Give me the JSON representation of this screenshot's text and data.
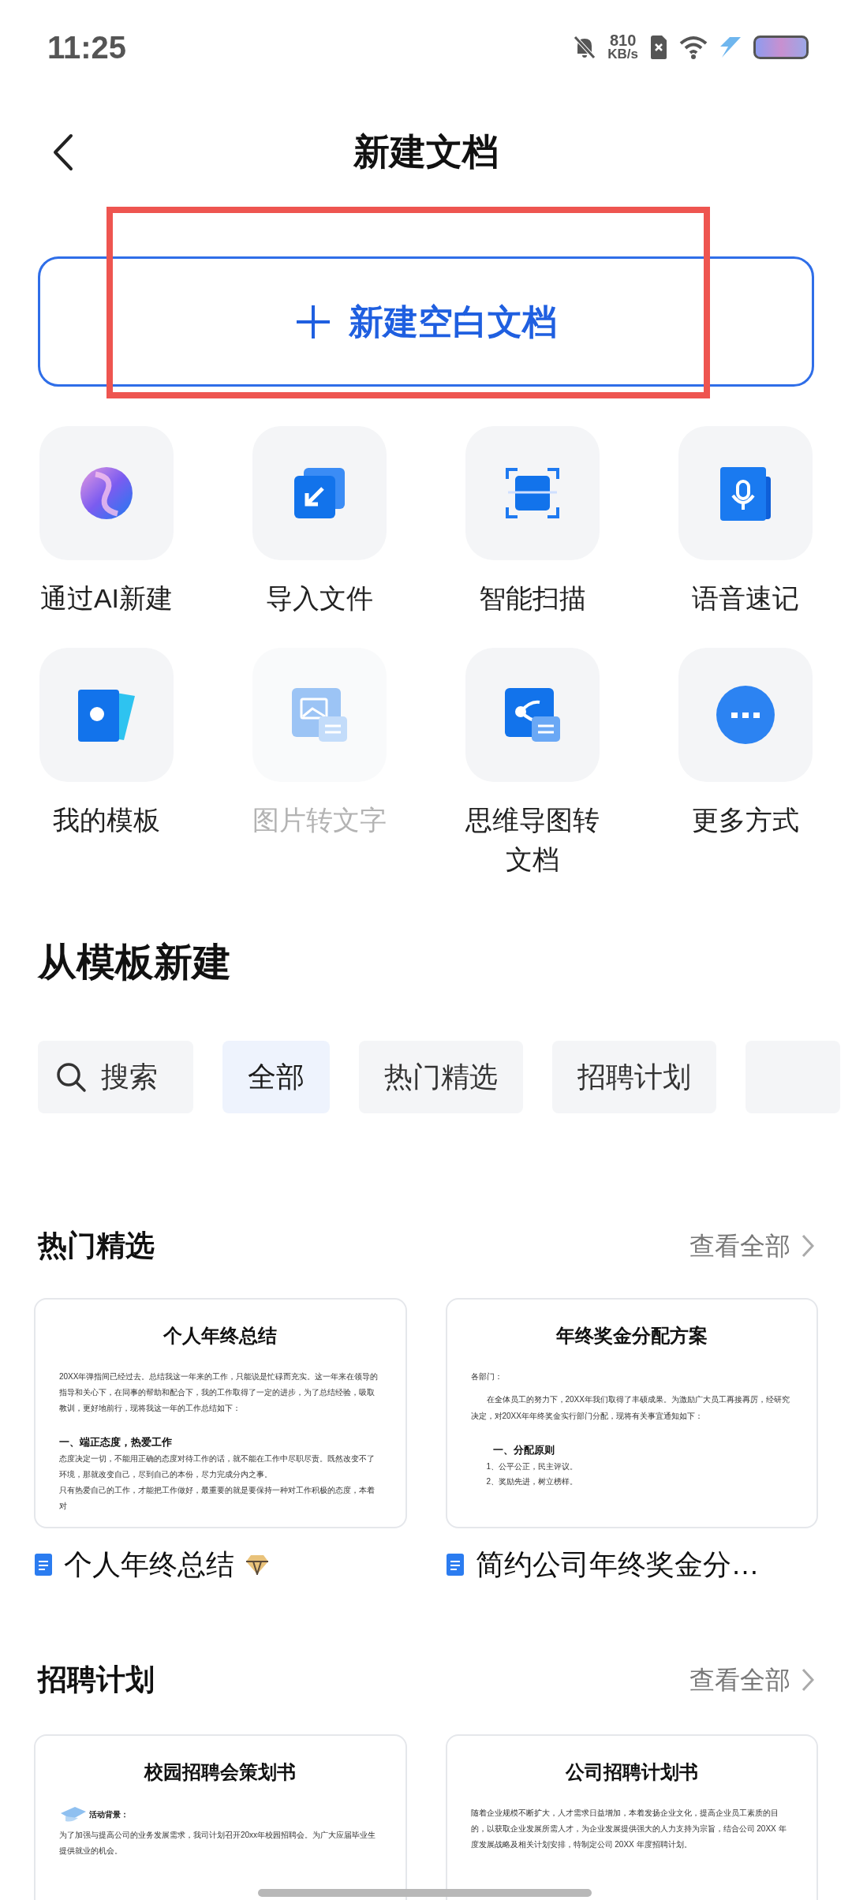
{
  "status_bar": {
    "time": "11:25",
    "net_speed": "810",
    "net_unit": "KB/s"
  },
  "header": {
    "title": "新建文档"
  },
  "new_blank": {
    "label": "新建空白文档"
  },
  "actions": [
    {
      "kind": "ai",
      "label": "通过AI新建",
      "disabled": false
    },
    {
      "kind": "import",
      "label": "导入文件",
      "disabled": false
    },
    {
      "kind": "scan",
      "label": "智能扫描",
      "disabled": false
    },
    {
      "kind": "voice",
      "label": "语音速记",
      "disabled": false
    },
    {
      "kind": "template",
      "label": "我的模板",
      "disabled": false
    },
    {
      "kind": "image_text",
      "label": "图片转文字",
      "disabled": true
    },
    {
      "kind": "mindmap",
      "label": "思维导图转文档",
      "disabled": false
    },
    {
      "kind": "more",
      "label": "更多方式",
      "disabled": false
    }
  ],
  "template_section": {
    "title": "从模板新建"
  },
  "filters": [
    {
      "kind": "search",
      "label": "搜索",
      "selected": false
    },
    {
      "kind": "chip",
      "label": "全部",
      "selected": true
    },
    {
      "kind": "chip",
      "label": "热门精选",
      "selected": false
    },
    {
      "kind": "chip",
      "label": "招聘计划",
      "selected": false
    },
    {
      "kind": "cut"
    }
  ],
  "groups": [
    {
      "title": "热门精选",
      "view_all": "查看全部",
      "templates": [
        {
          "name": "个人年终总结",
          "premium": true,
          "doc": {
            "title": "个人年终总结",
            "lines": [
              {
                "kind": "p",
                "text": "20XX年弹指间已经过去。总结我这一年来的工作，只能说是忙碌而充实。这一年来在领导的指导和关心下，在同事的帮助和配合下，我的工作取得了一定的进步，为了总结经验，吸取教训，更好地前行，现将我这一年的工作总结如下："
              },
              {
                "kind": "h",
                "text": "一、端正态度，热爱工作"
              },
              {
                "kind": "p",
                "text": "态度决定一切，不能用正确的态度对待工作的话，就不能在工作中尽职尽责。既然改变不了环境，那就改变自己，尽到自己的本份，尽力完成分内之事。"
              },
              {
                "kind": "p",
                "text": "只有热爱自己的工作，才能把工作做好，最重要的就是要保持一种对工作积极的态度，本着对"
              }
            ]
          }
        },
        {
          "name": "简约公司年终奖金分…",
          "doc": {
            "title": "年终奖金分配方案",
            "lines": [
              {
                "kind": "label",
                "text": "各部门："
              },
              {
                "kind": "indent",
                "text": "在全体员工的努力下，20XX年我们取得了丰硕成果。为激励广大员工再接再厉，经研究决定，对20XX年年终奖金实行部门分配，现将有关事宜通知如下："
              },
              {
                "kind": "h2",
                "text": "一、分配原则"
              },
              {
                "kind": "item",
                "text": "1、公平公正，民主评议。"
              },
              {
                "kind": "item",
                "text": "2、奖励先进，树立榜样。"
              }
            ]
          }
        }
      ]
    },
    {
      "title": "招聘计划",
      "view_all": "查看全部",
      "templates": [
        {
          "doc": {
            "title": "校园招聘会策划书",
            "lines": [
              {
                "kind": "lead",
                "text": "活动背景："
              },
              {
                "kind": "p",
                "text": "为了加强与提高公司的业务发展需求，我司计划召开20xx年校园招聘会。为广大应届毕业生提供就业的机会。"
              }
            ]
          }
        },
        {
          "doc": {
            "title": "公司招聘计划书",
            "lines": [
              {
                "kind": "p",
                "text": "随着企业规模不断扩大，人才需求日益增加，本着发扬企业文化，提高企业员工素质的目的，以获取企业发展所需人才，为企业发展提供强大的人力支持为宗旨，结合公司 20XX 年度发展战略及相关计划安排，特制定公司 20XX 年度招聘计划。"
              }
            ]
          }
        }
      ]
    }
  ]
}
